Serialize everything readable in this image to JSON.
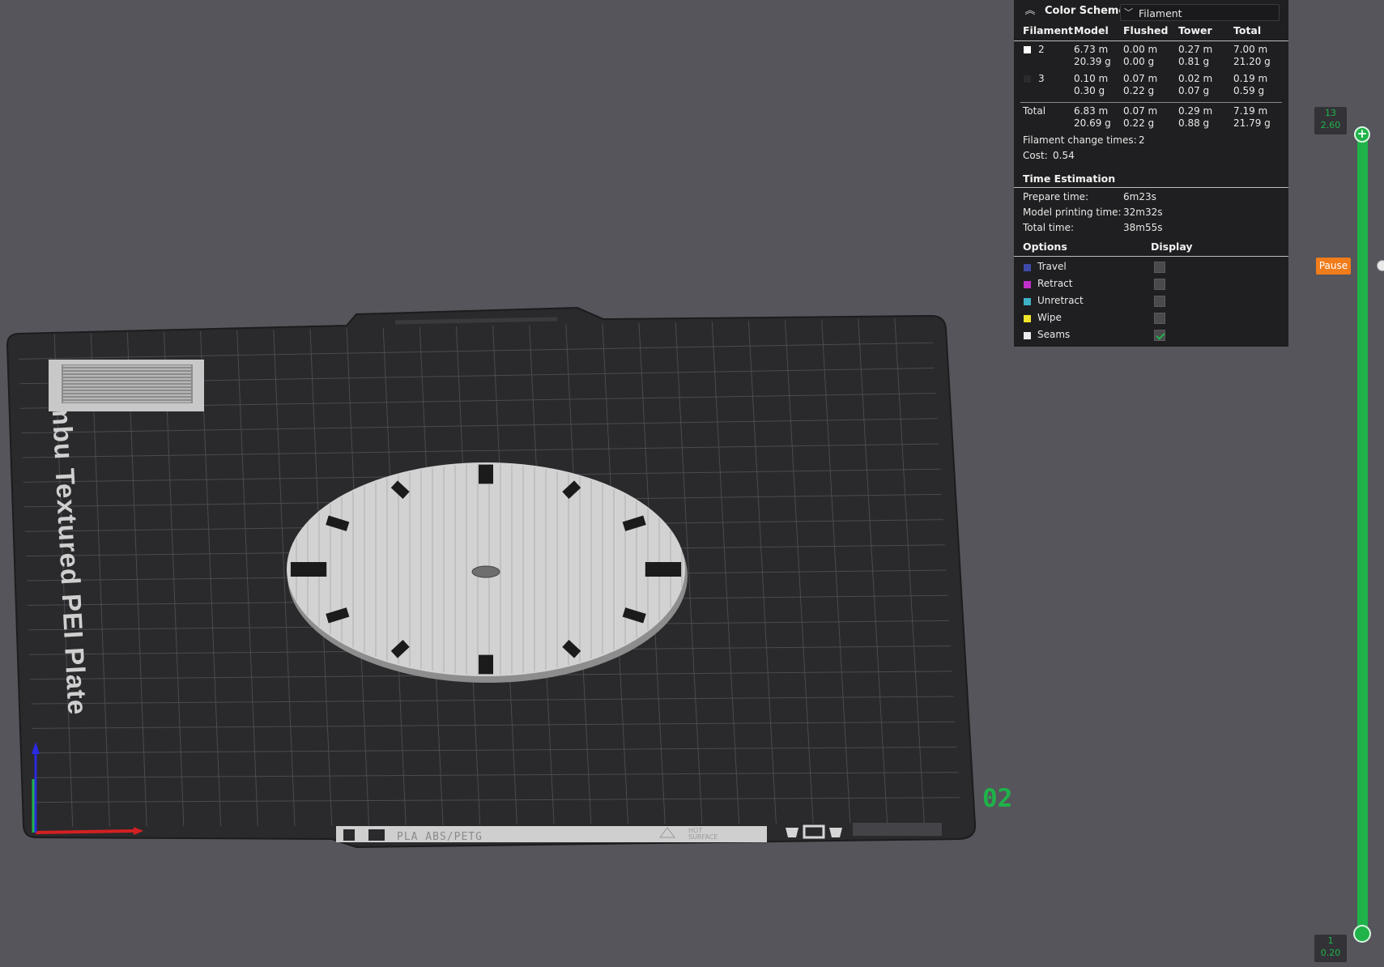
{
  "plate": {
    "label": "Bambu Textured PEI Plate",
    "bed_strip_text": "PLA ABS/PETG",
    "bed_strip_hot": "HOT",
    "bed_strip_surface": "SURFACE",
    "plate_number": "02"
  },
  "legend": {
    "color_scheme_label": "Color Scheme",
    "color_scheme_value": "Filament",
    "headers": [
      "Filament",
      "Model",
      "Flushed",
      "Tower",
      "Total"
    ],
    "filaments": [
      {
        "id": "2",
        "color": "#ffffff",
        "model": [
          "6.73 m",
          "20.39 g"
        ],
        "flushed": [
          "0.00 m",
          "0.00 g"
        ],
        "tower": [
          "0.27 m",
          "0.81 g"
        ],
        "total": [
          "7.00 m",
          "21.20 g"
        ]
      },
      {
        "id": "3",
        "color": "#2b2b2d",
        "model": [
          "0.10 m",
          "0.30 g"
        ],
        "flushed": [
          "0.07 m",
          "0.22 g"
        ],
        "tower": [
          "0.02 m",
          "0.07 g"
        ],
        "total": [
          "0.19 m",
          "0.59 g"
        ]
      }
    ],
    "total_row": {
      "label": "Total",
      "model": [
        "6.83 m",
        "20.69 g"
      ],
      "flushed": [
        "0.07 m",
        "0.22 g"
      ],
      "tower": [
        "0.29 m",
        "0.88 g"
      ],
      "total": [
        "7.19 m",
        "21.79 g"
      ]
    },
    "change_times_label": "Filament change times:",
    "change_times_value": "2",
    "cost_label": "Cost:",
    "cost_value": "0.54",
    "time_title": "Time Estimation",
    "times": [
      {
        "label": "Prepare time:",
        "value": "6m23s"
      },
      {
        "label": "Model printing time:",
        "value": "32m32s"
      },
      {
        "label": "Total time:",
        "value": "38m55s"
      }
    ],
    "options_header": "Options",
    "display_header": "Display",
    "options": [
      {
        "label": "Travel",
        "color": "#3d4aa8",
        "checked": false
      },
      {
        "label": "Retract",
        "color": "#c02fc8",
        "checked": false
      },
      {
        "label": "Unretract",
        "color": "#3fb0c8",
        "checked": false
      },
      {
        "label": "Wipe",
        "color": "#f0e52a",
        "checked": false
      },
      {
        "label": "Seams",
        "color": "#ececec",
        "checked": true
      }
    ]
  },
  "slider": {
    "top_layer": "13",
    "top_height": "2.60",
    "bottom_layer": "1",
    "bottom_height": "0.20",
    "pause_label": "Pause"
  }
}
